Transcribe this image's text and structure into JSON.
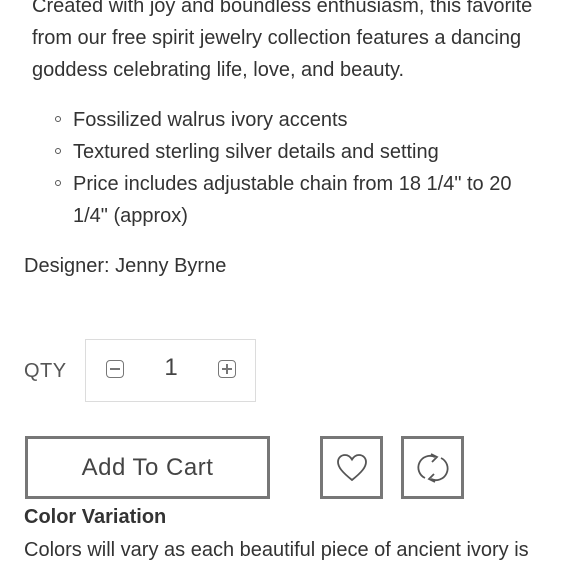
{
  "description": {
    "paragraph": "Created with joy and boundless enthusiasm, this favorite from our free spirit jewelry collection features a dancing goddess celebrating life, love, and beauty.",
    "bullets": [
      "Fossilized walrus ivory accents",
      "Textured sterling silver details and setting",
      "Price includes adjustable chain from 18 1/4\" to 20 1/4\" (approx)"
    ],
    "designer": "Designer: Jenny Byrne"
  },
  "purchase": {
    "qty_label": "QTY",
    "qty_value": "1",
    "add_to_cart_label": "Add To Cart",
    "icons": {
      "wishlist": "heart-icon",
      "compare": "refresh-icon",
      "decrease": "minus-icon",
      "increase": "plus-icon"
    }
  },
  "color_variation": {
    "title": "Color Variation",
    "text": "Colors will vary as each beautiful piece of ancient ivory is"
  }
}
